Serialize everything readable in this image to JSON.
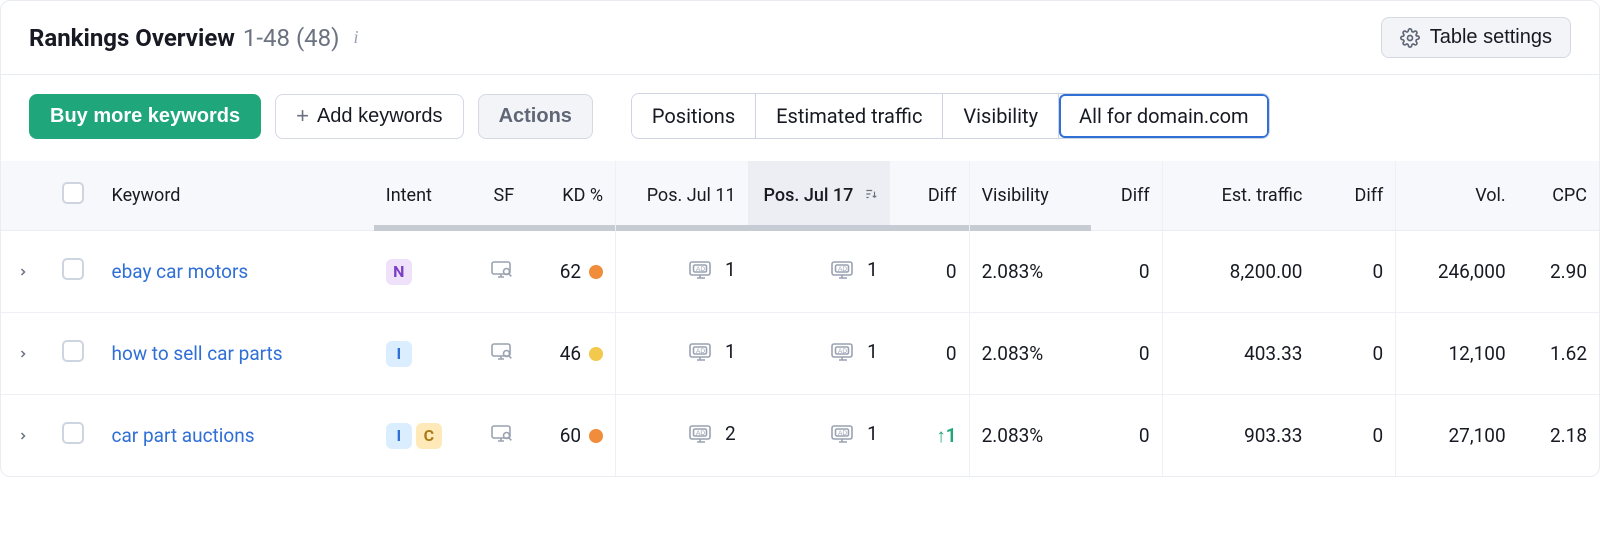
{
  "header": {
    "title": "Rankings Overview",
    "sub": "1-48 (48)",
    "settings_label": "Table settings"
  },
  "toolbar": {
    "buy_label": "Buy more keywords",
    "add_label": "Add keywords",
    "actions_label": "Actions",
    "tabs": [
      "Positions",
      "Estimated traffic",
      "Visibility",
      "All for domain.com"
    ],
    "active_tab_index": 3
  },
  "table": {
    "columns": {
      "keyword": "Keyword",
      "intent": "Intent",
      "sf": "SF",
      "kd": "KD %",
      "pos1": "Pos. Jul 11",
      "pos2": "Pos. Jul 17",
      "diff1": "Diff",
      "visibility": "Visibility",
      "diff2": "Diff",
      "est": "Est. traffic",
      "diff3": "Diff",
      "vol": "Vol.",
      "cpc": "CPC"
    },
    "sorted_column": "pos2",
    "rows": [
      {
        "keyword": "ebay car motors",
        "intent": [
          "N"
        ],
        "kd": 62,
        "kd_color": "orange",
        "pos1": 1,
        "pos2": 1,
        "diff1": "0",
        "visibility": "2.083%",
        "diff2": "0",
        "est": "8,200.00",
        "diff3": "0",
        "vol": "246,000",
        "cpc": "2.90"
      },
      {
        "keyword": "how to sell car parts",
        "intent": [
          "I"
        ],
        "kd": 46,
        "kd_color": "yellow",
        "pos1": 1,
        "pos2": 1,
        "diff1": "0",
        "visibility": "2.083%",
        "diff2": "0",
        "est": "403.33",
        "diff3": "0",
        "vol": "12,100",
        "cpc": "1.62"
      },
      {
        "keyword": "car part auctions",
        "intent": [
          "I",
          "C"
        ],
        "kd": 60,
        "kd_color": "orange",
        "pos1": 2,
        "pos2": 1,
        "diff1": "↑1",
        "diff1_up": true,
        "visibility": "2.083%",
        "diff2": "0",
        "est": "903.33",
        "diff3": "0",
        "vol": "27,100",
        "cpc": "2.18"
      }
    ]
  }
}
